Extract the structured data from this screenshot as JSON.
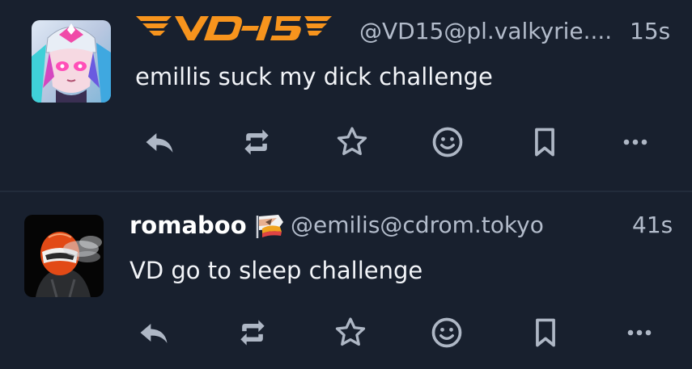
{
  "colors": {
    "background": "#18202e",
    "divider": "#222c3b",
    "text_primary": "#f2f4f8",
    "text_muted": "#b3bccb",
    "icon": "#aeb7c5",
    "logo_orange": "#f7941d"
  },
  "posts": [
    {
      "display_name_logo_text": "VD-15",
      "handle": "@VD15@pl.valkyrie....",
      "time": "15s",
      "content": "emillis suck my dick challenge",
      "avatar_icon": "anime-avatar-icon",
      "actions": [
        "reply-icon",
        "repeat-icon",
        "star-icon",
        "emoji-icon",
        "bookmark-icon",
        "more-icon"
      ]
    },
    {
      "display_name": "romaboo",
      "name_badge_icon": "rainbow-flag-icon",
      "handle": "@emilis@cdrom.tokyo",
      "time": "41s",
      "content": "VD go to sleep challenge",
      "avatar_icon": "helmet-avatar-icon",
      "actions": [
        "reply-icon",
        "repeat-icon",
        "star-icon",
        "emoji-icon",
        "bookmark-icon",
        "more-icon"
      ]
    }
  ]
}
